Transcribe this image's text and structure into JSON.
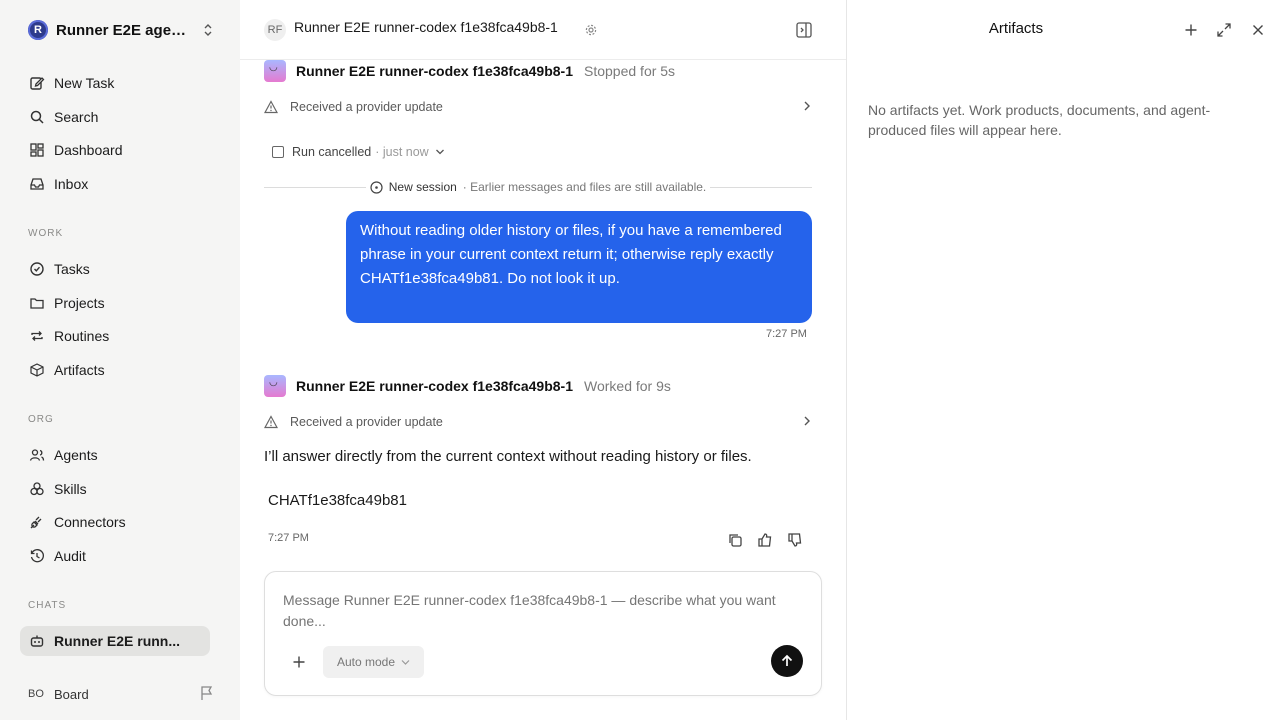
{
  "workspace": {
    "logo": "R",
    "name": "Runner E2E agen...",
    "icon": "chevron-updown-icon"
  },
  "sidebar": {
    "top_items": [
      {
        "label": "New Task",
        "icon": "edit-icon"
      },
      {
        "label": "Search",
        "icon": "search-icon"
      },
      {
        "label": "Dashboard",
        "icon": "dashboard-icon"
      },
      {
        "label": "Inbox",
        "icon": "inbox-icon"
      }
    ],
    "work_label": "WORK",
    "work_items": [
      {
        "label": "Tasks",
        "icon": "check-circle-icon"
      },
      {
        "label": "Projects",
        "icon": "folder-icon"
      },
      {
        "label": "Routines",
        "icon": "repeat-icon"
      },
      {
        "label": "Artifacts",
        "icon": "cube-icon"
      }
    ],
    "org_label": "ORG",
    "org_items": [
      {
        "label": "Agents",
        "icon": "users-icon"
      },
      {
        "label": "Skills",
        "icon": "skills-icon"
      },
      {
        "label": "Connectors",
        "icon": "plug-icon"
      },
      {
        "label": "Audit",
        "icon": "history-icon"
      }
    ],
    "chats_label": "CHATS",
    "chat_items": [
      {
        "label": "Runner E2E runn...",
        "icon": "bot-icon",
        "active": true
      }
    ],
    "board": {
      "initials": "BO",
      "label": "Board",
      "icon": "flag-icon"
    }
  },
  "header": {
    "initials": "RF",
    "title": "Runner E2E runner-codex f1e38fca49b8-1"
  },
  "thread": {
    "run1": {
      "agent": "Runner E2E runner-codex f1e38fca49b8-1",
      "status": "Stopped for 5s",
      "update": "Received a provider update"
    },
    "cancel": {
      "label": "Run cancelled",
      "time": "· just now"
    },
    "session": {
      "label": "New session",
      "note": "· Earlier messages and files are still available."
    },
    "user_message": "Without reading older history or files, if you have a remembered phrase in your current context return it; otherwise reply exactly CHATf1e38fca49b81. Do not look it up.",
    "user_time": "7:27 PM",
    "run2": {
      "agent": "Runner E2E runner-codex f1e38fca49b8-1",
      "status": "Worked for 9s",
      "update": "Received a provider update"
    },
    "answer": "I’ll answer directly from the current context without reading history or files.",
    "answer_code": "CHATf1e38fca49b81",
    "answer_time": "7:27 PM"
  },
  "composer": {
    "placeholder": "Message Runner E2E runner-codex f1e38fca49b8-1 — describe what you want done...",
    "mode": "Auto mode"
  },
  "artifacts_panel": {
    "title": "Artifacts",
    "empty": "No artifacts yet. Work products, documents, and agent-produced files will appear here."
  },
  "colors": {
    "accent": "#2563eb",
    "sidebar_bg": "#f5f5f4",
    "send": "#111111"
  }
}
